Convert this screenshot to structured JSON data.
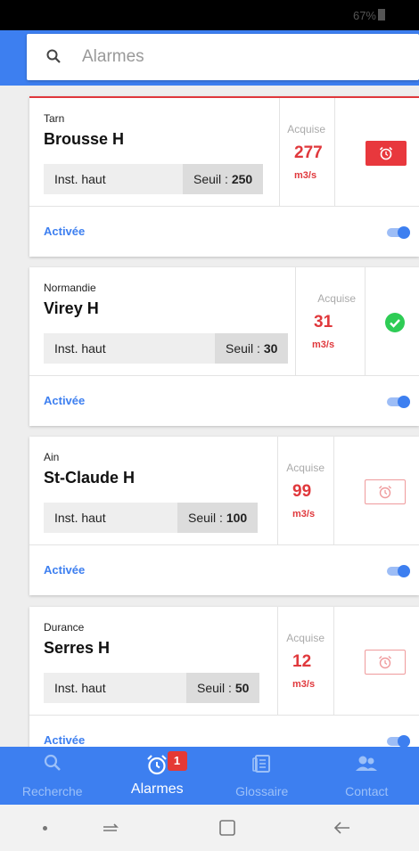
{
  "status_bar": {
    "battery": "67%"
  },
  "search": {
    "placeholder": "Alarmes"
  },
  "colors": {
    "primary": "#3d7ff0",
    "alert": "#e0383c",
    "ok": "#2ecc55"
  },
  "cards": [
    {
      "region": "Tarn",
      "station": "Brousse H",
      "type": "Inst. haut",
      "seuil_label": "Seuil : ",
      "seuil_value": "250",
      "acquise_label": "Acquise",
      "value": "277",
      "unit": "m3/s",
      "status": "alarm-active",
      "activation": "Activée",
      "enabled": true
    },
    {
      "region": "Normandie",
      "station": "Virey H",
      "type": "Inst. haut",
      "seuil_label": "Seuil : ",
      "seuil_value": "30",
      "acquise_label": "Acquise",
      "value": "31",
      "unit": "m3/s",
      "status": "ok",
      "activation": "Activée",
      "enabled": true
    },
    {
      "region": "Ain",
      "station": "St-Claude H",
      "type": "Inst. haut",
      "seuil_label": "Seuil : ",
      "seuil_value": "100",
      "acquise_label": "Acquise",
      "value": "99",
      "unit": "m3/s",
      "status": "alarm-idle",
      "activation": "Activée",
      "enabled": true
    },
    {
      "region": "Durance",
      "station": "Serres H",
      "type": "Inst. haut",
      "seuil_label": "Seuil : ",
      "seuil_value": "50",
      "acquise_label": "Acquise",
      "value": "12",
      "unit": "m3/s",
      "status": "alarm-idle",
      "activation": "Activée",
      "enabled": true
    }
  ],
  "nav": [
    {
      "label": "Recherche",
      "icon": "search-icon",
      "active": false
    },
    {
      "label": "Alarmes",
      "icon": "alarm-clock-icon",
      "active": true,
      "badge": "1"
    },
    {
      "label": "Glossaire",
      "icon": "glossary-icon",
      "active": false
    },
    {
      "label": "Contact",
      "icon": "contact-icon",
      "active": false
    }
  ]
}
